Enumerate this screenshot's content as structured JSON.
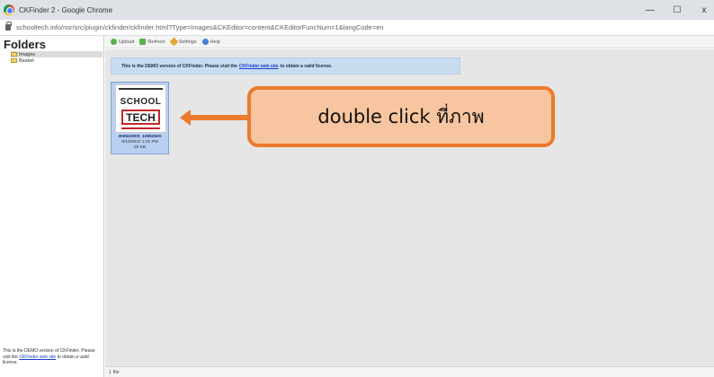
{
  "window": {
    "title": "CKFinder 2 - Google Chrome",
    "minimize": "—",
    "maximize": "☐",
    "close": "x"
  },
  "address": {
    "url": "schooltech.info/nsr/src/plugin/ckfinder/ckfinder.html?Type=Images&CKEditor=content&CKEditorFuncNum=1&langCode=en"
  },
  "sidebar": {
    "title": "Folders",
    "folders": [
      {
        "label": "Images"
      },
      {
        "label": "Basket"
      }
    ],
    "footer_text_1": "This is the DEMO version of CKFinder. Please visit the ",
    "footer_link": "CKFinder web site",
    "footer_text_2": " to obtain a valid license."
  },
  "toolbar": {
    "upload": "Upload",
    "refresh": "Refresh",
    "settings": "Settings",
    "help": "Help"
  },
  "banner": {
    "text_1": "This is the DEMO version of CKFinder. Please visit the",
    "link": "CKFinder web site",
    "text_2": "to obtain a valid license."
  },
  "file": {
    "thumb_line1": "SCHOOL",
    "thumb_line2": "TECH",
    "name": "300520000_10552500",
    "date": "9/10/2022 1:31 PM",
    "size": "50 KB"
  },
  "annotation": {
    "text": "double click ที่ภาพ",
    "color_fill": "#f7c59f",
    "color_border": "#ec7a2c"
  },
  "status": {
    "count": "1 file"
  }
}
